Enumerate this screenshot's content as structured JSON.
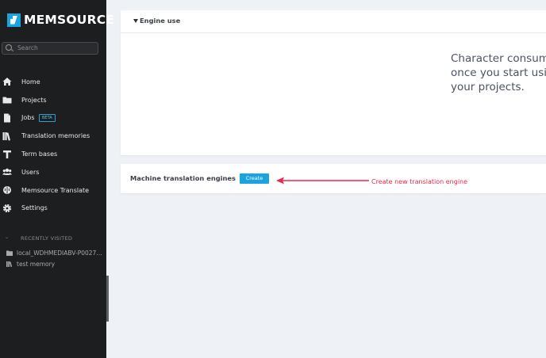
{
  "sidebar": {
    "brand": "MEMSOURCE",
    "search": {
      "placeholder": "Search"
    },
    "items": [
      {
        "label": "Home",
        "icon": "home-icon"
      },
      {
        "label": "Projects",
        "icon": "folder-icon"
      },
      {
        "label": "Jobs",
        "icon": "document-icon",
        "badge": "BETA"
      },
      {
        "label": "Translation memories",
        "icon": "books-icon"
      },
      {
        "label": "Term bases",
        "icon": "text-t-icon"
      },
      {
        "label": "Users",
        "icon": "users-icon"
      },
      {
        "label": "Memsource Translate",
        "icon": "brain-icon"
      },
      {
        "label": "Settings",
        "icon": "gear-icon"
      }
    ],
    "recent": {
      "title": "RECENTLY VISITED",
      "items": [
        {
          "label": "local_WDHMEDIABV-P0027…",
          "icon": "folder-icon"
        },
        {
          "label": "test memory",
          "icon": "books-icon"
        }
      ]
    }
  },
  "main": {
    "engine_use": {
      "title": "Engine use",
      "message_lines": [
        "Character consumpt",
        "once you start using",
        "your projects."
      ]
    },
    "mt_engines": {
      "label": "Machine translation engines",
      "create_label": "Create"
    },
    "annotation": {
      "text": "Create new translation engine",
      "color": "#e8284c"
    }
  },
  "colors": {
    "accent": "#1aa3df",
    "sidebar_bg": "#1d1e20",
    "page_bg": "#eef1f5"
  }
}
